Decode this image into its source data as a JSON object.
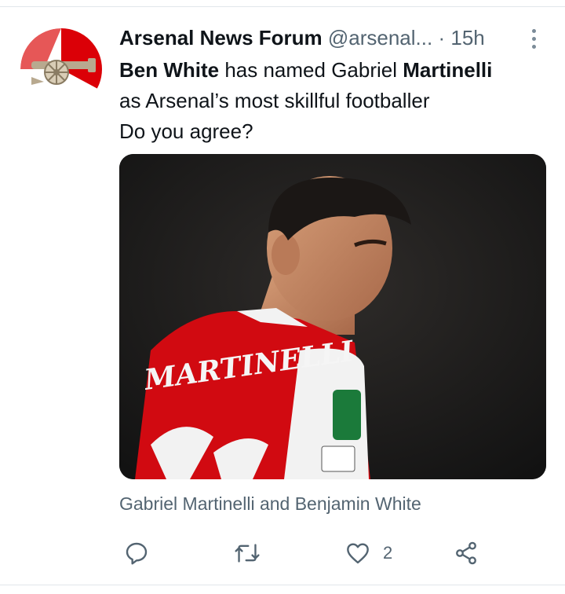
{
  "colors": {
    "accent": "#db0007",
    "text_primary": "#0f1419",
    "text_secondary": "#536471",
    "icon": "#536471"
  },
  "tweet": {
    "author_name": "Arsenal News Forum",
    "author_handle": "@arsenal...",
    "separator": "·",
    "time": "15h",
    "text": {
      "line1_bold_a": "Ben White",
      "line1_rest": " has named Gabriel ",
      "line1_bold_b": "Martinelli",
      "line2": "as Arsenal’s most skillful footballer",
      "line3": "Do you agree?"
    },
    "media_caption": "Gabriel Martinelli and Benjamin White",
    "media_jersey_text": "MARTINELLI",
    "actions": {
      "reply_icon": "speech-bubble-icon",
      "retweet_icon": "retweet-icon",
      "like_icon": "heart-icon",
      "like_count": "2",
      "share_icon": "share-icon"
    }
  }
}
